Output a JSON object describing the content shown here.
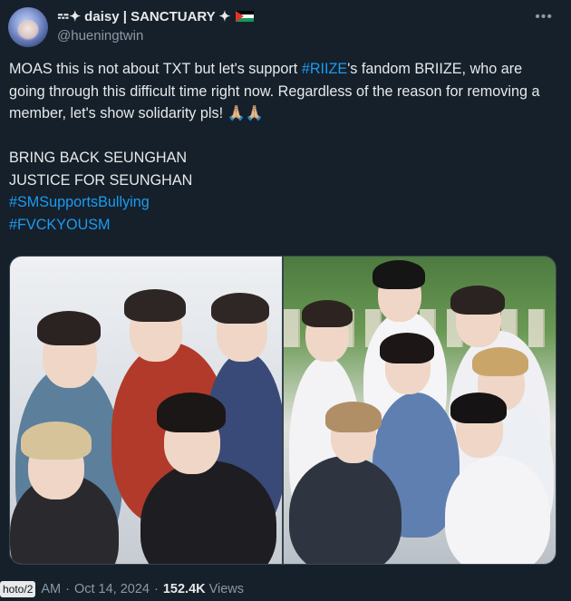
{
  "author": {
    "display_name": "𝌂✦ daisy | SANCTUARY ✦",
    "handle": "@hueningtwin",
    "avatar": "avatar"
  },
  "more_icon": "more-icon",
  "tweet": {
    "paragraph1_part1": "MOAS this is not about TXT but let's support ",
    "paragraph1_hashtag": "#RIIZE",
    "paragraph1_part2": "'s fandom BRIIZE, who are going through this difficult time right now. Regardless of the reason for removing a member, let's show solidarity pls! 🙏🏼🙏🏼",
    "line1": "BRING BACK SEUNGHAN",
    "line2": "JUSTICE FOR SEUNGHAN",
    "hashtag1": "#SMSupportsBullying",
    "hashtag2": "#FVCKYOUSM"
  },
  "media": {
    "photo1": "group photo of TXT members",
    "photo2": "group photo of RIIZE members"
  },
  "meta": {
    "photo_tag": "hoto/2",
    "time": "AM",
    "date": "Oct 14, 2024",
    "views_count": "152.4K",
    "views_label": "Views"
  },
  "colors": {
    "background": "#15202b",
    "text": "#e7e9ea",
    "secondary": "#8b98a5",
    "link": "#1d9bf0"
  }
}
